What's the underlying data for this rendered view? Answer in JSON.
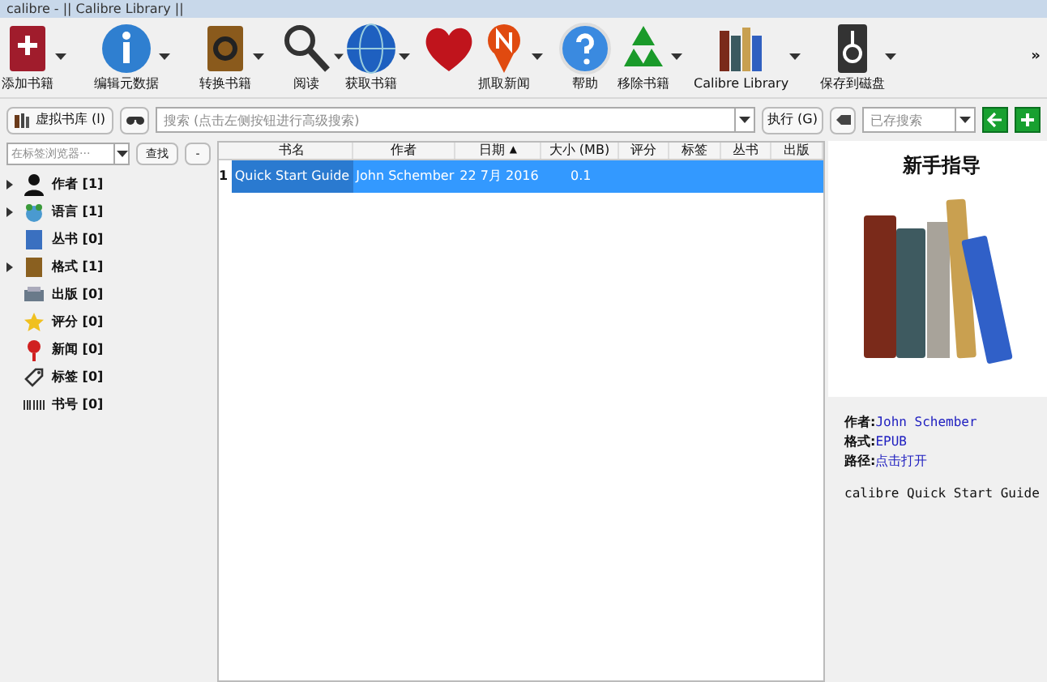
{
  "window": {
    "title": "calibre - || Calibre Library ||"
  },
  "toolbar": [
    {
      "label": "添加书籍",
      "has_menu": true
    },
    {
      "label": "编辑元数据",
      "has_menu": true
    },
    {
      "label": "转换书籍",
      "has_menu": true
    },
    {
      "label": "阅读",
      "has_menu": true
    },
    {
      "label": "获取书籍",
      "has_menu": true
    },
    {
      "has_menu": false
    },
    {
      "label": "抓取新闻",
      "has_menu": true
    },
    {
      "label": "帮助",
      "has_menu": false
    },
    {
      "label": "移除书籍",
      "has_menu": true
    },
    {
      "label": "Calibre Library",
      "has_menu": true
    },
    {
      "label": "保存到磁盘",
      "has_menu": true
    }
  ],
  "toolbar_more": "»",
  "search_bar": {
    "virtual_library": "虚拟书库 (l)",
    "placeholder": "搜索 (点击左侧按钮进行高级搜索)",
    "go_button": "执行 (G)",
    "saved_search_placeholder": "已存搜索"
  },
  "tag_browser": {
    "placeholder": "在标签浏览器···",
    "find_button": "查找",
    "collapse_button": "-",
    "items": [
      {
        "label": "作者 [1]",
        "expandable": true
      },
      {
        "label": "语言 [1]",
        "expandable": true
      },
      {
        "label": "丛书 [0]",
        "expandable": false
      },
      {
        "label": "格式 [1]",
        "expandable": true
      },
      {
        "label": "出版 [0]",
        "expandable": false
      },
      {
        "label": "评分 [0]",
        "expandable": false
      },
      {
        "label": "新闻 [0]",
        "expandable": false
      },
      {
        "label": "标签 [0]",
        "expandable": false
      },
      {
        "label": "书号 [0]",
        "expandable": false
      }
    ]
  },
  "table": {
    "columns": [
      {
        "label": "书名",
        "sorted": false
      },
      {
        "label": "作者",
        "sorted": false
      },
      {
        "label": "日期",
        "sorted": true
      },
      {
        "label": "大小 (MB)",
        "sorted": false
      },
      {
        "label": "评分",
        "sorted": false
      },
      {
        "label": "标签",
        "sorted": false
      },
      {
        "label": "丛书",
        "sorted": false
      },
      {
        "label": "出版",
        "sorted": false
      }
    ],
    "sort_indicator": "▲",
    "rows": [
      {
        "number": "1",
        "selected": true,
        "cells": [
          "Quick Start Guide",
          "John Schember",
          "22 7月 2016",
          "0.1",
          "",
          "",
          "",
          ""
        ]
      }
    ]
  },
  "details": {
    "title": "新手指导",
    "fields": [
      {
        "label": "作者:",
        "value": "John Schember"
      },
      {
        "label": "格式:",
        "value": "EPUB"
      },
      {
        "label": "路径:",
        "value": "点击打开"
      }
    ],
    "comment": "calibre Quick Start Guide"
  }
}
